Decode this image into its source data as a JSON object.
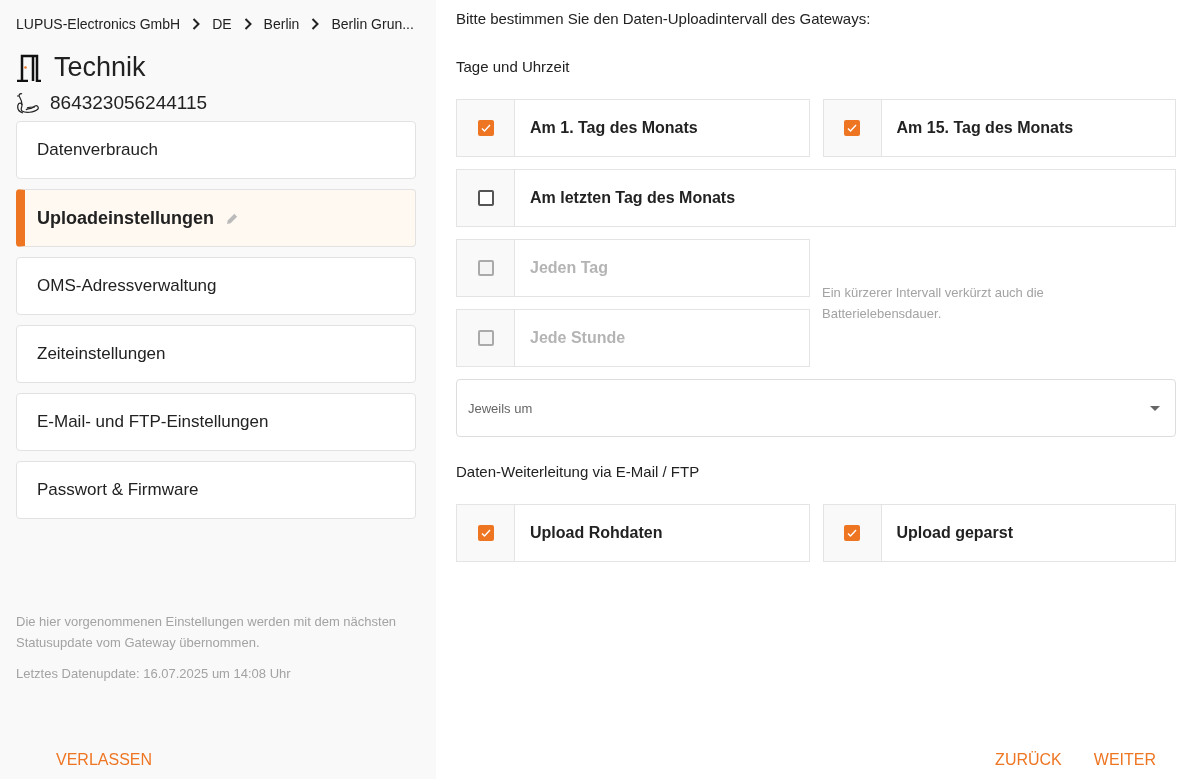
{
  "breadcrumb": [
    "LUPUS-Electronics GmbH",
    "DE",
    "Berlin",
    "Berlin Grun..."
  ],
  "title": "Technik",
  "device_id": "864323056244115",
  "nav": [
    {
      "label": "Datenverbrauch",
      "selected": false
    },
    {
      "label": "Uploadeinstellungen",
      "selected": true
    },
    {
      "label": "OMS-Adressverwaltung",
      "selected": false
    },
    {
      "label": "Zeiteinstellungen",
      "selected": false
    },
    {
      "label": "E-Mail- und FTP-Einstellungen",
      "selected": false
    },
    {
      "label": "Passwort & Firmware",
      "selected": false
    }
  ],
  "sidebar_note": "Die hier vorgenommenen Einstellungen werden mit dem nächsten Statusupdate vom Gateway übernommen.",
  "last_update": "Letztes Datenupdate: 16.07.2025 um 14:08 Uhr",
  "intro": "Bitte bestimmen Sie den Daten-Uploadintervall des Gateways:",
  "schedule_heading": "Tage und Uhrzeit",
  "monthly_options": [
    {
      "label": "Am 1. Tag des Monats",
      "checked": true,
      "disabled": false
    },
    {
      "label": "Am 15. Tag des Monats",
      "checked": true,
      "disabled": false
    },
    {
      "label": "Am letzten Tag des Monats",
      "checked": false,
      "disabled": false
    }
  ],
  "frequent_options": [
    {
      "label": "Jeden Tag",
      "checked": false,
      "disabled": true
    },
    {
      "label": "Jede Stunde",
      "checked": false,
      "disabled": true
    }
  ],
  "hint": "Ein kürzerer Intervall verkürzt auch die Batterielebensdauer.",
  "time_select": {
    "placeholder": "Jeweils um"
  },
  "forward_heading": "Daten-Weiterleitung via E-Mail / FTP",
  "upload_options": [
    {
      "label": "Upload Rohdaten",
      "checked": true,
      "disabled": false
    },
    {
      "label": "Upload geparst",
      "checked": true,
      "disabled": false
    }
  ],
  "actions": {
    "leave": "VERLASSEN",
    "back": "ZURÜCK",
    "next": "WEITER"
  }
}
